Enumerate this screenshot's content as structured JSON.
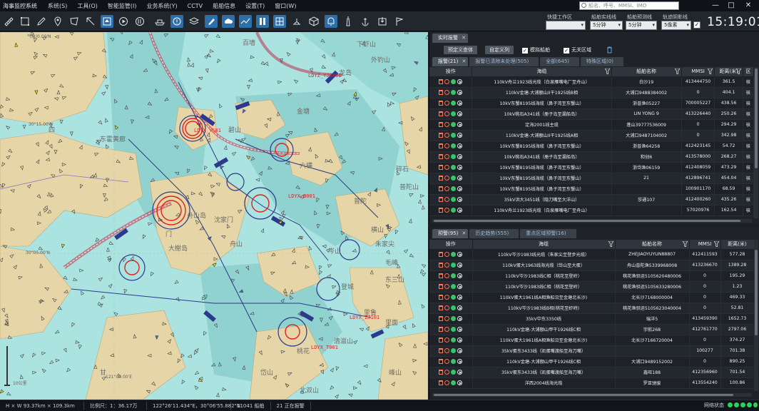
{
  "menubar": {
    "app_title": "海事监控系统",
    "items": [
      "系统(S)",
      "工具(O)",
      "智能监管(I)",
      "业务系统(Y)",
      "CCTV",
      "船舶信息",
      "设置(T)",
      "窗口(W)"
    ],
    "search_placeholder": "船名、呼号、MMSI、IMO"
  },
  "window_controls": {
    "minimize": "—",
    "maximize": "□",
    "close": "✕"
  },
  "toolbar": {
    "quick_workspace_label": "快捷工作区",
    "track_line_label": "船舶实线线",
    "track_line_value": "5分钟",
    "prediction_line_label": "船舶预测线",
    "prediction_line_value": "5分钟",
    "track_shadow_label": "轨迹阴影线",
    "track_shadow_value": "5像素",
    "clock": "15:19:01",
    "tool_icons": [
      "ruler-icon",
      "select-box-icon",
      "pen-icon",
      "location-pin-icon",
      "polygon-icon",
      "cursor-icon",
      "play-icon",
      "replay-icon",
      "ship-icon",
      "alert-icon",
      "layers-icon",
      "brush-icon",
      "cloud-icon",
      "chart-icon",
      "pause-icon",
      "grid-icon",
      "radar-icon",
      "cube-icon",
      "bell-icon",
      "lighthouse-icon",
      "anchor-icon",
      "export-icon",
      "flag-icon"
    ]
  },
  "map": {
    "scale": "10公里",
    "coords": [
      "30°15.00'N",
      "30°05.00'N",
      "121°00.00'E",
      "气象|0.00'N"
    ],
    "places": [
      "东霍黄廊",
      "四",
      "舟山岛",
      "岑山",
      "普陀",
      "朱家尖",
      "登城",
      "毛峰",
      "桃花",
      "金塘",
      "百墙",
      "横山",
      "六横",
      "清滋山",
      "舟山",
      "大榭岛",
      "沈家门",
      "下虾山",
      "外钓山",
      "龙岛",
      "碎石",
      "东三山",
      "里鲁",
      "北双山",
      "峰山",
      "门",
      "里面",
      "普陀山",
      "甘",
      "碧山",
      "岱山"
    ],
    "vessel_labels": [
      "LDYZ_YJS001",
      "LDYX_YS01",
      "LDYX_B001",
      "LDYX_ZJ101",
      "LDYX_T001"
    ]
  },
  "top_panel": {
    "title_tab": "实时报警",
    "buttons": {
      "custom": "预定义查体",
      "define_list": "自定义列"
    },
    "checkboxes": [
      {
        "label": "模拟船舶",
        "checked": true
      },
      {
        "label": "无关区域",
        "checked": true
      }
    ],
    "tabs": [
      {
        "label": "报警(21)",
        "active": true
      },
      {
        "label": "报警已清除未处理(505)",
        "active": false
      },
      {
        "label": "全部(645)",
        "active": false
      },
      {
        "label": "特殊区域(0)",
        "active": false
      }
    ],
    "columns": [
      "操作",
      "海缆",
      "船舶名称",
      "MMSI",
      "距离(米)",
      "区"
    ],
    "rows": [
      [
        "110kV舟兰1923线光缆（白泉雁嘴电厂至舟山）",
        "白沙19",
        "413444750",
        "361.5",
        "核"
      ],
      [
        "110kV金塘-大浦额山II干1925线B相",
        "大浦口9488384002",
        "0",
        "404.1",
        "核"
      ],
      [
        "10kV东蟹8195线海缆（鼻子湾至东蟹山）",
        "浙普渔05227",
        "700005227",
        "438.56",
        "核"
      ],
      [
        "10kV桃石A341线（册子岛至漏船岛）",
        "LIN YONG 9",
        "413226440",
        "250.26",
        "核"
      ],
      [
        "定海2001线主缆",
        "蓬山39777536009",
        "0",
        "294.29",
        "核"
      ],
      [
        "110kV金塘-大浦额山II干1925线A相",
        "大浦口9487104002",
        "0",
        "342.98",
        "核"
      ],
      [
        "10kV东蟹8195线海缆（鼻子湾至东蟹山）",
        "浙普渔64258",
        "412423145",
        "54.72",
        "核"
      ],
      [
        "10kV桃石A341线（册子岛至漏船岛）",
        "和创6",
        "413578000",
        "268.27",
        "核"
      ],
      [
        "10kV东蟹8195线海缆（鼻子湾至东蟹山）",
        "浙岱渔06159",
        "412408059",
        "473.29",
        "核"
      ],
      [
        "10kV东蟹8195线海缆（鼻子湾至东蟹山）",
        "21",
        "412896741",
        "454.04",
        "核"
      ],
      [
        "10kV东蟹8195线海缆（鼻子湾至东蟹山）",
        "",
        "100901170",
        "68.59",
        "核"
      ],
      [
        "35kV洪大3451线（隐刀嘴至大洋山）",
        "莎通107",
        "412400260",
        "435.26",
        "核"
      ],
      [
        "110kV舟兰1923线光缆（白泉雁嘴电厂至舟山）",
        "",
        "57020976",
        "162.54",
        "核"
      ]
    ]
  },
  "bottom_panel": {
    "tabs": [
      {
        "label": "预警(95)",
        "active": true
      },
      {
        "label": "历史趋势(555)",
        "active": false
      },
      {
        "label": "重点区域预警(16)",
        "active": false
      }
    ],
    "columns": [
      "操作",
      "海缆",
      "船舶名称",
      "MMSI",
      "距离(米)"
    ],
    "rows": [
      [
        "110kV岑沙1983线光缆（朱家尖至登步光缆）",
        "ZHEJIAOYUYUN88807",
        "412411593",
        "577.28"
      ],
      [
        "110kV蛋大1963线海光缆（岱山至大蛋）",
        "舟山普陀渔5339968008",
        "413236670",
        "1389.28"
      ],
      [
        "110kV岑沙1983线C相（桃花至登岭）",
        "桃花渔驳运5105620480006",
        "0",
        "195.29"
      ],
      [
        "110kV岑沙1983线C相（桃花至登岭）",
        "桃花渔驳运5105633280006",
        "0",
        "1.23"
      ],
      [
        "110kV蛋大1961线A相渔船沿至金塘北长沙)",
        "北长沙7168000004",
        "0",
        "469.33"
      ],
      [
        "110kV岑沙1983线B相(桃花至虾峙)",
        "桃花渔驳运5105623040004",
        "0",
        "52.81"
      ],
      [
        "35kV中东3350线",
        "瑞洋5",
        "413459390",
        "1652.73"
      ],
      [
        "110kV金塘-大浦额山甲干1926线C相",
        "宇航268",
        "412761770",
        "2797.06"
      ],
      [
        "110kV蛋大1961线A相渔船沿至金塘北长沙)",
        "北长沙7166720004",
        "0",
        "374.27"
      ],
      [
        "35kV蛋东3433线（凯蛋嘴渡船至海刀嘴）",
        "",
        "100277",
        "701.38"
      ],
      [
        "110kV金塘-大浦额山甲干1926线C相",
        "大浦口9489152002",
        "0",
        "890.25"
      ],
      [
        "35kV蛋东3433线（凯蛋嘴渡船至海刀嘴）",
        "鑫旺188",
        "412356960",
        "701.54"
      ],
      [
        "洋西2004线海光缆",
        "罗亚驰骏",
        "413554240",
        "100.86"
      ]
    ]
  },
  "statusbar": {
    "dims": "H × W 93.37km × 109.3km",
    "scale": "比例尺：1：36.17万",
    "coords": "122°26'11.434\"E，30°06'55.882\"N",
    "vessels": "11041 船舶",
    "alarms": "21 正在报警",
    "network_label": "网络状态"
  },
  "colors": {
    "sea": "#abe3e0",
    "land": "#e6d6a7",
    "shallow": "#8fd2cf",
    "accent": "#2e6fa8",
    "alarm_red": "#e02020",
    "net_ok": "#2fd05a"
  }
}
